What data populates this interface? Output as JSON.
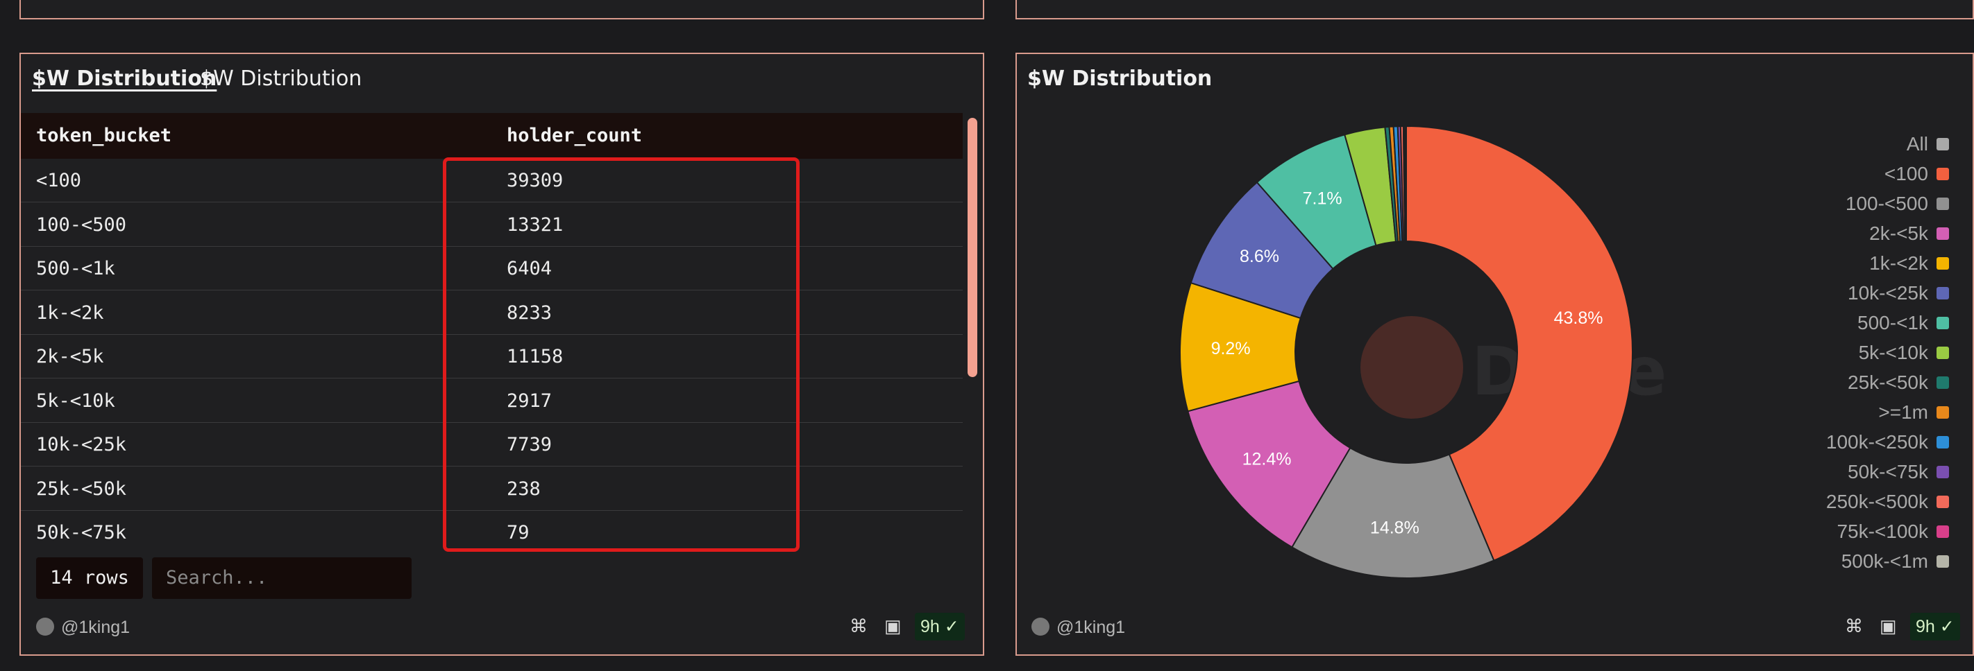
{
  "left_panel": {
    "title_link": "$W Distribution",
    "title": "$W Distribution",
    "columns": [
      "token_bucket",
      "holder_count"
    ],
    "rows": [
      {
        "token_bucket": "<100",
        "holder_count": "39309"
      },
      {
        "token_bucket": "100-<500",
        "holder_count": "13321"
      },
      {
        "token_bucket": "500-<1k",
        "holder_count": "6404"
      },
      {
        "token_bucket": "1k-<2k",
        "holder_count": "8233"
      },
      {
        "token_bucket": "2k-<5k",
        "holder_count": "11158"
      },
      {
        "token_bucket": "5k-<10k",
        "holder_count": "2917"
      },
      {
        "token_bucket": "10k-<25k",
        "holder_count": "7739"
      },
      {
        "token_bucket": "25k-<50k",
        "holder_count": "238"
      },
      {
        "token_bucket": "50k-<75k",
        "holder_count": "79"
      }
    ],
    "rows_count": "14 rows",
    "search_placeholder": "Search...",
    "author": "@1king1",
    "age": "9h"
  },
  "right_panel": {
    "title": "$W Distribution",
    "author": "@1king1",
    "age": "9h",
    "watermark": "Dune"
  },
  "chart_data": {
    "type": "pie",
    "donut": true,
    "slices": [
      {
        "label": "<100",
        "value": 43.8,
        "color": "#f2603f",
        "shown_label": "43.8%"
      },
      {
        "label": "100-<500",
        "value": 14.8,
        "color": "#919191",
        "shown_label": "14.8%"
      },
      {
        "label": "2k-<5k",
        "value": 12.4,
        "color": "#d35fb4",
        "shown_label": "12.4%"
      },
      {
        "label": "1k-<2k",
        "value": 9.2,
        "color": "#f4b400",
        "shown_label": "9.2%"
      },
      {
        "label": "10k-<25k",
        "value": 8.6,
        "color": "#5e67b5",
        "shown_label": "8.6%"
      },
      {
        "label": "500-<1k",
        "value": 7.1,
        "color": "#4fbfa3",
        "shown_label": "7.1%"
      },
      {
        "label": "5k-<10k",
        "value": 2.9,
        "color": "#9acb43",
        "shown_label": ""
      },
      {
        "label": "25k-<50k",
        "value": 0.3,
        "color": "#1f7a6d",
        "shown_label": ""
      },
      {
        "label": ">=1m",
        "value": 0.3,
        "color": "#e8881b",
        "shown_label": ""
      },
      {
        "label": "100k-<250k",
        "value": 0.3,
        "color": "#2d8fd8",
        "shown_label": ""
      },
      {
        "label": "50k-<75k",
        "value": 0.2,
        "color": "#7a4fb0",
        "shown_label": ""
      },
      {
        "label": "250k-<500k",
        "value": 0.2,
        "color": "#f26a5a",
        "shown_label": ""
      },
      {
        "label": "75k-<100k",
        "value": 0.1,
        "color": "#d83f8a",
        "shown_label": ""
      },
      {
        "label": "500k-<1m",
        "value": 0.1,
        "color": "#b4b4a8",
        "shown_label": ""
      }
    ],
    "legend": [
      {
        "label": "All",
        "color": "#a9a9a9"
      },
      {
        "label": "<100",
        "color": "#f2603f"
      },
      {
        "label": "100-<500",
        "color": "#919191"
      },
      {
        "label": "2k-<5k",
        "color": "#d35fb4"
      },
      {
        "label": "1k-<2k",
        "color": "#f4b400"
      },
      {
        "label": "10k-<25k",
        "color": "#5e67b5"
      },
      {
        "label": "500-<1k",
        "color": "#4fbfa3"
      },
      {
        "label": "5k-<10k",
        "color": "#9acb43"
      },
      {
        "label": "25k-<50k",
        "color": "#1f7a6d"
      },
      {
        "label": ">=1m",
        "color": "#e8881b"
      },
      {
        "label": "100k-<250k",
        "color": "#2d8fd8"
      },
      {
        "label": "50k-<75k",
        "color": "#7a4fb0"
      },
      {
        "label": "250k-<500k",
        "color": "#f26a5a"
      },
      {
        "label": "75k-<100k",
        "color": "#d83f8a"
      },
      {
        "label": "500k-<1m",
        "color": "#b4b4a8"
      }
    ],
    "legend_position": "right"
  },
  "colors": {
    "frame_border": "#d99b8d",
    "highlight": "#e01b1b",
    "scroll_thumb": "#f4a190"
  }
}
